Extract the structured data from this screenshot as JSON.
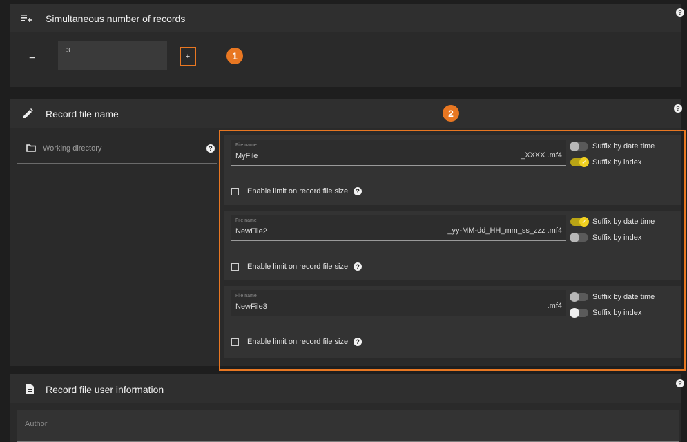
{
  "sections": {
    "simultaneous": {
      "title": "Simultaneous number of records",
      "icon": "playlist-add-icon"
    },
    "record_file_name": {
      "title": "Record file name",
      "icon": "pencil-icon"
    },
    "user_info": {
      "title": "Record file user information",
      "icon": "document-icon"
    }
  },
  "stepper": {
    "minus": "−",
    "value": "3",
    "plus": "+"
  },
  "badges": {
    "one": "1",
    "two": "2"
  },
  "working_directory": {
    "label": "Working directory",
    "icon": "folder-icon"
  },
  "files": [
    {
      "field_label": "File name",
      "name": "MyFile",
      "suffix": "_XXXX .mf4",
      "toggle_date_label": "Suffix by date time",
      "toggle_date_on": false,
      "toggle_index_label": "Suffix by index",
      "toggle_index_on": true,
      "limit_label": "Enable limit on record file size"
    },
    {
      "field_label": "File name",
      "name": "NewFile2",
      "suffix": "_yy-MM-dd_HH_mm_ss_zzz .mf4",
      "toggle_date_label": "Suffix by date time",
      "toggle_date_on": true,
      "toggle_index_label": "Suffix by index",
      "toggle_index_on": false,
      "limit_label": "Enable limit on record file size"
    },
    {
      "field_label": "File name",
      "name": "NewFile3",
      "suffix": ".mf4",
      "toggle_date_label": "Suffix by date time",
      "toggle_date_on": false,
      "toggle_index_label": "Suffix by index",
      "toggle_index_on": false,
      "limit_label": "Enable limit on record file size"
    }
  ],
  "author": {
    "placeholder": "Author"
  },
  "colors": {
    "accent": "#e87722",
    "toggle_on": "#f0d020",
    "background": "#1e1e1e",
    "panel": "#2a2a2a",
    "header": "#2f2f2f"
  }
}
